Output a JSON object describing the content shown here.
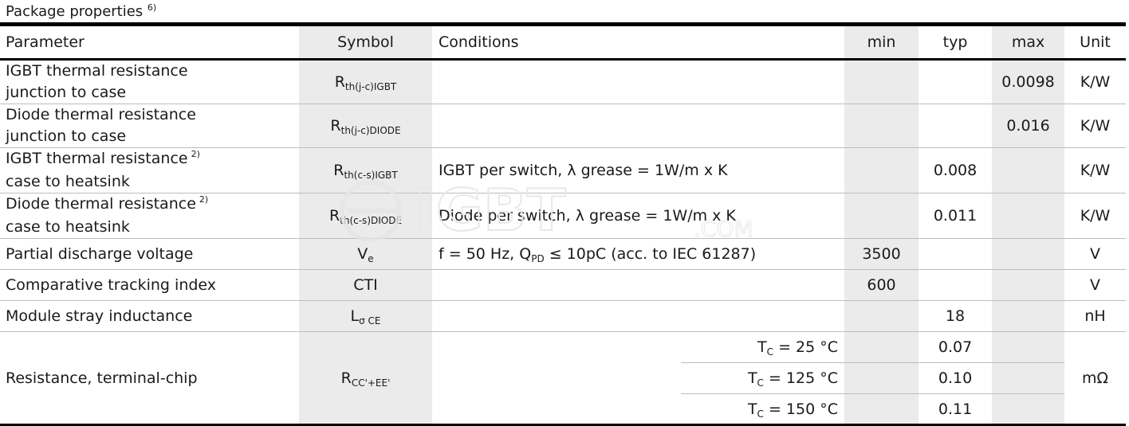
{
  "title": "Package properties",
  "title_note": "6)",
  "headers": [
    "Parameter",
    "Symbol",
    "Conditions",
    "min",
    "typ",
    "max",
    "Unit"
  ],
  "rows": [
    {
      "param_lines": [
        "IGBT thermal resistance",
        "junction to case"
      ],
      "note": "",
      "sym_main": "R",
      "sym_sub": "th(j-c)IGBT",
      "cond": "",
      "min": "",
      "typ": "",
      "max": "0.0098",
      "unit": "K/W"
    },
    {
      "param_lines": [
        "Diode thermal resistance",
        "junction to case"
      ],
      "note": "",
      "sym_main": "R",
      "sym_sub": "th(j-c)DIODE",
      "cond": "",
      "min": "",
      "typ": "",
      "max": "0.016",
      "unit": "K/W"
    },
    {
      "param_lines": [
        "IGBT thermal resistance",
        "case to heatsink"
      ],
      "note": "2)",
      "sym_main": "R",
      "sym_sub": "th(c-s)IGBT",
      "cond": "IGBT per switch, λ grease = 1W/m x K",
      "min": "",
      "typ": "0.008",
      "max": "",
      "unit": "K/W"
    },
    {
      "param_lines": [
        "Diode thermal resistance",
        "case to heatsink"
      ],
      "note": "2)",
      "sym_main": "R",
      "sym_sub": "th(c-s)DIODE",
      "cond": "Diode per switch, λ grease = 1W/m x K",
      "min": "",
      "typ": "0.011",
      "max": "",
      "unit": "K/W"
    },
    {
      "param_lines": [
        "Partial discharge voltage"
      ],
      "note": "",
      "sym_main": "V",
      "sym_sub": "e",
      "cond_pre": "f = 50 Hz, Q",
      "cond_sub": "PD",
      "cond_post": " ≤ 10pC (acc. to IEC 61287)",
      "min": "3500",
      "typ": "",
      "max": "",
      "unit": "V"
    },
    {
      "param_lines": [
        "Comparative tracking index"
      ],
      "note": "",
      "sym_main": "CTI",
      "sym_sub": "",
      "cond": "",
      "min": "600",
      "typ": "",
      "max": "",
      "unit": "V"
    },
    {
      "param_lines": [
        "Module stray inductance"
      ],
      "note": "",
      "sym_main": "L",
      "sym_sub": "σ CE",
      "cond": "",
      "min": "",
      "typ": "18",
      "max": "",
      "unit": "nH"
    }
  ],
  "resistance": {
    "param": "Resistance, terminal-chip",
    "sym_main": "R",
    "sym_sub": "CC'+EE'",
    "unit": "mΩ",
    "subrows": [
      {
        "t_main": "T",
        "t_sub": "C",
        "t_post": " = 25 °C",
        "typ": "0.07"
      },
      {
        "t_main": "T",
        "t_sub": "C",
        "t_post": " = 125 °C",
        "typ": "0.10"
      },
      {
        "t_main": "T",
        "t_sub": "C",
        "t_post": " = 150 °C",
        "typ": "0.11"
      }
    ]
  },
  "watermark": "eIGBT.COM"
}
